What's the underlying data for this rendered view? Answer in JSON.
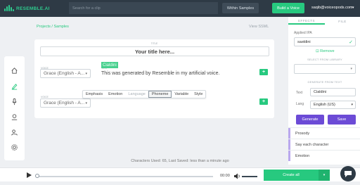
{
  "brand": {
    "name": "RESEMBLE.AI"
  },
  "topbar": {
    "search_placeholder": "Search for a clip",
    "within_label": "Within Samples",
    "build_label": "Build a Voice",
    "user_email": "saqib@voiceopods.com"
  },
  "sidebar": {
    "items": [
      {
        "icon": "home-icon"
      },
      {
        "icon": "pencil-icon"
      },
      {
        "icon": "microphone-icon"
      },
      {
        "icon": "upload-icon"
      },
      {
        "icon": "user-settings-icon"
      },
      {
        "icon": "gear-icon"
      }
    ]
  },
  "breadcrumb": {
    "project": "Projects",
    "separator": "/",
    "current": "Samples"
  },
  "editor": {
    "view_ssml_label": "View SSML",
    "title_label": "TITLE",
    "title_placeholder": "Your title here...",
    "lines": [
      {
        "voice_label": "VOICE",
        "voice": "Grace (English - A...",
        "text_label": "TEXT",
        "text": "This was generated by Resemble in my artificial voice.",
        "add_label": "+"
      },
      {
        "voice_label": "VOICE",
        "voice": "Grace (English - A...",
        "highlight": "Cialdini",
        "add_label": "+"
      }
    ],
    "toolbar": [
      "Emphasis",
      "Emotion",
      "Language",
      "Phoneme",
      "Variable",
      "Style"
    ]
  },
  "right_panel": {
    "tabs": [
      "EFFECTS",
      "FILE"
    ],
    "applied_ipa_label": "Applied IPA",
    "ipa_value": "saəldini",
    "remove_label": "Remove",
    "select_library_label": "SELECT FROM LIBRARY",
    "generate_label": "GENERATE FROM TEXT",
    "text_label": "Text",
    "text_value": "Cialdini",
    "lang_label": "Lang",
    "lang_value": "English (US)",
    "generate_button": "Generate",
    "save_button": "Save",
    "list": [
      "Prosody",
      "Say each character",
      "Emotion"
    ]
  },
  "status": {
    "text": "Characters Used: 65, Last Saved: less than a minute ago"
  },
  "player": {
    "time": "00:00",
    "create_all_label": "Create all",
    "progress_fraction": 0.0,
    "volume_fraction": 1.0
  },
  "colors": {
    "accent": "#27c97f",
    "topbar": "#2e3a45",
    "purple": "#6c4bd6"
  }
}
